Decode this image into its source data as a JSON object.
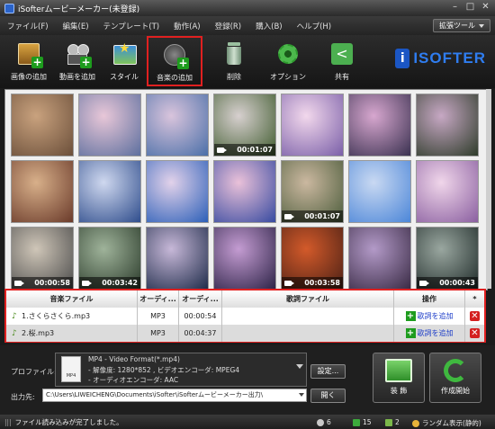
{
  "window": {
    "title": "iSofterムービーメーカー(未登録)"
  },
  "menu": {
    "items": [
      "ファイル(F)",
      "編集(E)",
      "テンプレート(T)",
      "動作(A)",
      "登録(R)",
      "購入(B)",
      "ヘルプ(H)"
    ],
    "extension_tools": "拡張ツール"
  },
  "toolbar": {
    "add_image": "画像の追加",
    "add_video": "動画を追加",
    "style": "スタイル",
    "add_music": "音楽の追加",
    "delete": "削除",
    "options": "オプション",
    "share": "共有"
  },
  "logo": {
    "text": "ISOFTER",
    "mark": "i"
  },
  "media": {
    "items": [
      {
        "type": "image",
        "colors": [
          "#6b4f3a",
          "#c9a27e"
        ]
      },
      {
        "type": "image",
        "colors": [
          "#5d6f9e",
          "#e8c7d8"
        ]
      },
      {
        "type": "image",
        "colors": [
          "#4a6fa8",
          "#d9c4dc"
        ]
      },
      {
        "type": "video",
        "duration": "00:01:07",
        "colors": [
          "#3e5a2d",
          "#d7d0cf"
        ]
      },
      {
        "type": "image",
        "colors": [
          "#7a5fa8",
          "#f2d8ec"
        ]
      },
      {
        "type": "image",
        "colors": [
          "#3a3150",
          "#d7a7cf"
        ]
      },
      {
        "type": "image",
        "colors": [
          "#2e3c2a",
          "#c7a8c4"
        ]
      },
      {
        "type": "image",
        "colors": [
          "#6a3a2a",
          "#d8b08a"
        ]
      },
      {
        "type": "image",
        "colors": [
          "#2f4d8c",
          "#cfd8ef"
        ]
      },
      {
        "type": "image",
        "colors": [
          "#2c5fb8",
          "#e2d2ea"
        ]
      },
      {
        "type": "image",
        "colors": [
          "#374aa0",
          "#eac1d9"
        ]
      },
      {
        "type": "video",
        "duration": "00:01:07",
        "colors": [
          "#4a5b3a",
          "#cbb8a0"
        ]
      },
      {
        "type": "image",
        "colors": [
          "#4c86d8",
          "#c9d9f2"
        ]
      },
      {
        "type": "image",
        "colors": [
          "#8a5fa0",
          "#f0d6ea"
        ]
      },
      {
        "type": "video",
        "duration": "00:00:58",
        "colors": [
          "#4a4a4a",
          "#cfc6b8"
        ]
      },
      {
        "type": "video",
        "duration": "00:03:42",
        "colors": [
          "#2a3a2a",
          "#9fb39a"
        ]
      },
      {
        "type": "image",
        "colors": [
          "#1f2c4a",
          "#c7b8d8"
        ]
      },
      {
        "type": "image",
        "colors": [
          "#2e2448",
          "#c49cd2"
        ]
      },
      {
        "type": "video",
        "duration": "00:03:58",
        "colors": [
          "#4a2015",
          "#d35a2a"
        ]
      },
      {
        "type": "image",
        "colors": [
          "#3a2b45",
          "#b39ac8"
        ]
      },
      {
        "type": "video",
        "duration": "00:00:43",
        "colors": [
          "#1e2a28",
          "#9aa7a0"
        ]
      },
      {
        "type": "image",
        "colors": [
          "#5a4a3a",
          "#d8c8c0"
        ]
      },
      {
        "type": "image",
        "colors": [
          "#5b7aa8",
          "#e3d6e8"
        ]
      },
      {
        "type": "image",
        "colors": [
          "#6b4a8c",
          "#e0c4e2"
        ]
      },
      {
        "type": "image",
        "colors": [
          "#2a3a2a",
          "#9ab0a0"
        ]
      },
      {
        "type": "image",
        "colors": [
          "#39508c",
          "#d9cce8"
        ]
      },
      {
        "type": "image",
        "colors": [
          "#b43a7a",
          "#f0bcd8"
        ]
      },
      {
        "type": "image",
        "colors": [
          "#3a3a3a",
          "#b8a8b0"
        ]
      }
    ]
  },
  "music": {
    "headers": [
      "音楽ファイル",
      "オーディ...",
      "オーディ...",
      "歌詞ファイル",
      "操作",
      "*"
    ],
    "rows": [
      {
        "name": "1.さくらさくら.mp3",
        "format": "MP3",
        "duration": "00:00:54",
        "lyric": "",
        "action": "歌詞を追加"
      },
      {
        "name": "2.桜.mp3",
        "format": "MP3",
        "duration": "00:04:37",
        "lyric": "",
        "action": "歌詞を追加"
      }
    ]
  },
  "profile": {
    "label": "プロファイル:",
    "format": "MP4 - Video Format(*.mp4)",
    "resolution": "- 解像度: 1280*852 , ビデオエンコーダ: MPEG4",
    "audio": "- オーディオエンコーダ: AAC",
    "settings": "設定...",
    "icon_text": "MP4"
  },
  "output": {
    "label": "出力先:",
    "path": "C:\\Users\\LIWEICHENG\\Documents\\iSofter\\iSofterムービーメーカー出力\\",
    "open": "開く"
  },
  "actions": {
    "decorate": "装 飾",
    "start": "作成開始"
  },
  "status": {
    "message": "ファイル読み込みが完了しました。",
    "count_images": "6",
    "count_video": "15",
    "count_music": "2",
    "random": "ランダム表示(静的)"
  },
  "colors": {
    "highlight": "#e02020",
    "brand": "#2f7df0",
    "green": "#1e9c1e"
  }
}
